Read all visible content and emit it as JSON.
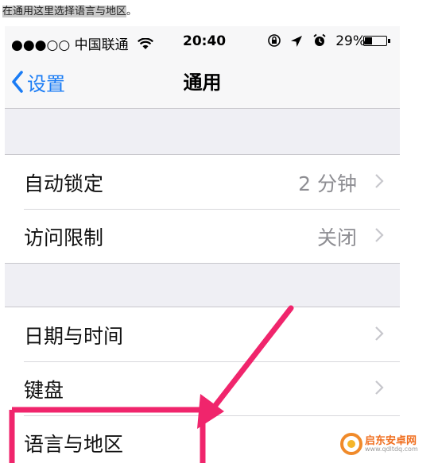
{
  "caption": {
    "highlighted": "在通用这里选择语言与地区",
    "trailing": "。"
  },
  "status_bar": {
    "carrier": "●●●○○ 中国联通",
    "time": "20:40",
    "battery_percent": "29%",
    "battery_level": 0.29
  },
  "nav": {
    "back_label": "设置",
    "title": "通用"
  },
  "group1": [
    {
      "label": "自动锁定",
      "value": "2 分钟"
    },
    {
      "label": "访问限制",
      "value": "关闭"
    }
  ],
  "group2": [
    {
      "label": "日期与时间",
      "value": ""
    },
    {
      "label": "键盘",
      "value": ""
    },
    {
      "label": "语言与地区",
      "value": ""
    }
  ],
  "annotation": {
    "color": "#f0256c"
  },
  "watermark": {
    "name": "启东安卓网",
    "url": "www.qdltdq.com"
  },
  "colors": {
    "accent": "#1a7cf5",
    "grouped_background": "#efeff4"
  }
}
